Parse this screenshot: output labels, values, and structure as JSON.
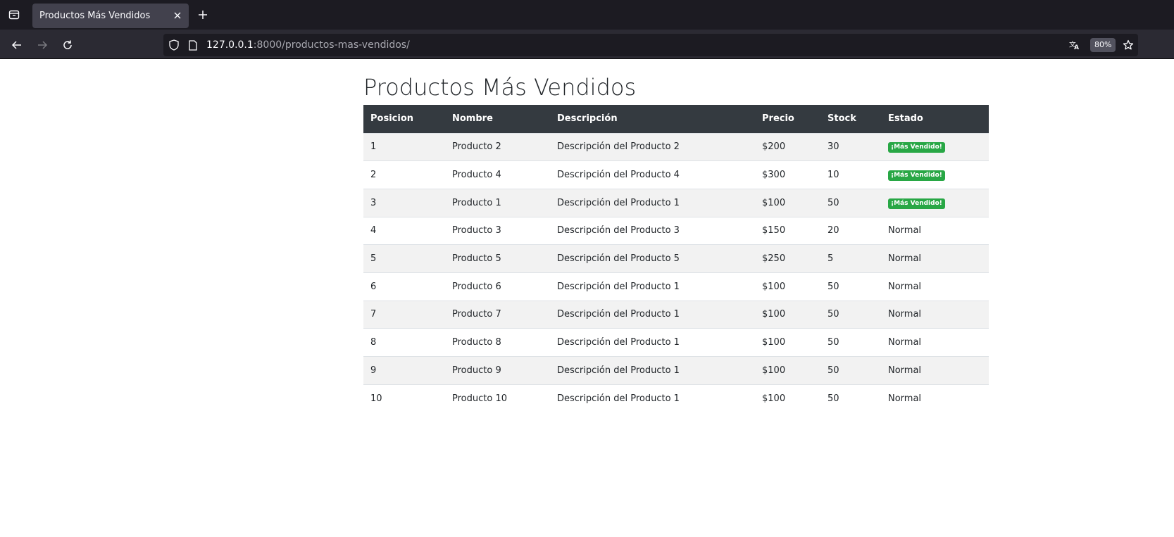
{
  "browser": {
    "tab_title": "Productos Más Vendidos",
    "url_host": "127.0.0.1",
    "url_rest": ":8000/productos-mas-vendidos/",
    "zoom": "80%"
  },
  "page": {
    "title": "Productos Más Vendidos",
    "columns": [
      "Posicion",
      "Nombre",
      "Descripción",
      "Precio",
      "Stock",
      "Estado"
    ],
    "rows": [
      {
        "pos": "1",
        "nombre": "Producto 2",
        "descripcion": "Descripción del Producto 2",
        "precio": "$200",
        "stock": "30",
        "estado": "¡Más Vendido!",
        "badge": true
      },
      {
        "pos": "2",
        "nombre": "Producto 4",
        "descripcion": "Descripción del Producto 4",
        "precio": "$300",
        "stock": "10",
        "estado": "¡Más Vendido!",
        "badge": true
      },
      {
        "pos": "3",
        "nombre": "Producto 1",
        "descripcion": "Descripción del Producto 1",
        "precio": "$100",
        "stock": "50",
        "estado": "¡Más Vendido!",
        "badge": true
      },
      {
        "pos": "4",
        "nombre": "Producto 3",
        "descripcion": "Descripción del Producto 3",
        "precio": "$150",
        "stock": "20",
        "estado": "Normal",
        "badge": false
      },
      {
        "pos": "5",
        "nombre": "Producto 5",
        "descripcion": "Descripción del Producto 5",
        "precio": "$250",
        "stock": "5",
        "estado": "Normal",
        "badge": false
      },
      {
        "pos": "6",
        "nombre": "Producto 6",
        "descripcion": "Descripción del Producto 1",
        "precio": "$100",
        "stock": "50",
        "estado": "Normal",
        "badge": false
      },
      {
        "pos": "7",
        "nombre": "Producto 7",
        "descripcion": "Descripción del Producto 1",
        "precio": "$100",
        "stock": "50",
        "estado": "Normal",
        "badge": false
      },
      {
        "pos": "8",
        "nombre": "Producto 8",
        "descripcion": "Descripción del Producto 1",
        "precio": "$100",
        "stock": "50",
        "estado": "Normal",
        "badge": false
      },
      {
        "pos": "9",
        "nombre": "Producto 9",
        "descripcion": "Descripción del Producto 1",
        "precio": "$100",
        "stock": "50",
        "estado": "Normal",
        "badge": false
      },
      {
        "pos": "10",
        "nombre": "Producto 10",
        "descripcion": "Descripción del Producto 1",
        "precio": "$100",
        "stock": "50",
        "estado": "Normal",
        "badge": false
      }
    ]
  },
  "colors": {
    "table_header_bg": "#343a40",
    "badge_green": "#28a745",
    "chrome_dark": "#1c1b22"
  },
  "icons": [
    "tab-list-icon",
    "close-icon",
    "plus-icon",
    "back-arrow-icon",
    "forward-arrow-icon",
    "reload-icon",
    "shield-icon",
    "page-icon",
    "translate-icon",
    "star-icon"
  ]
}
